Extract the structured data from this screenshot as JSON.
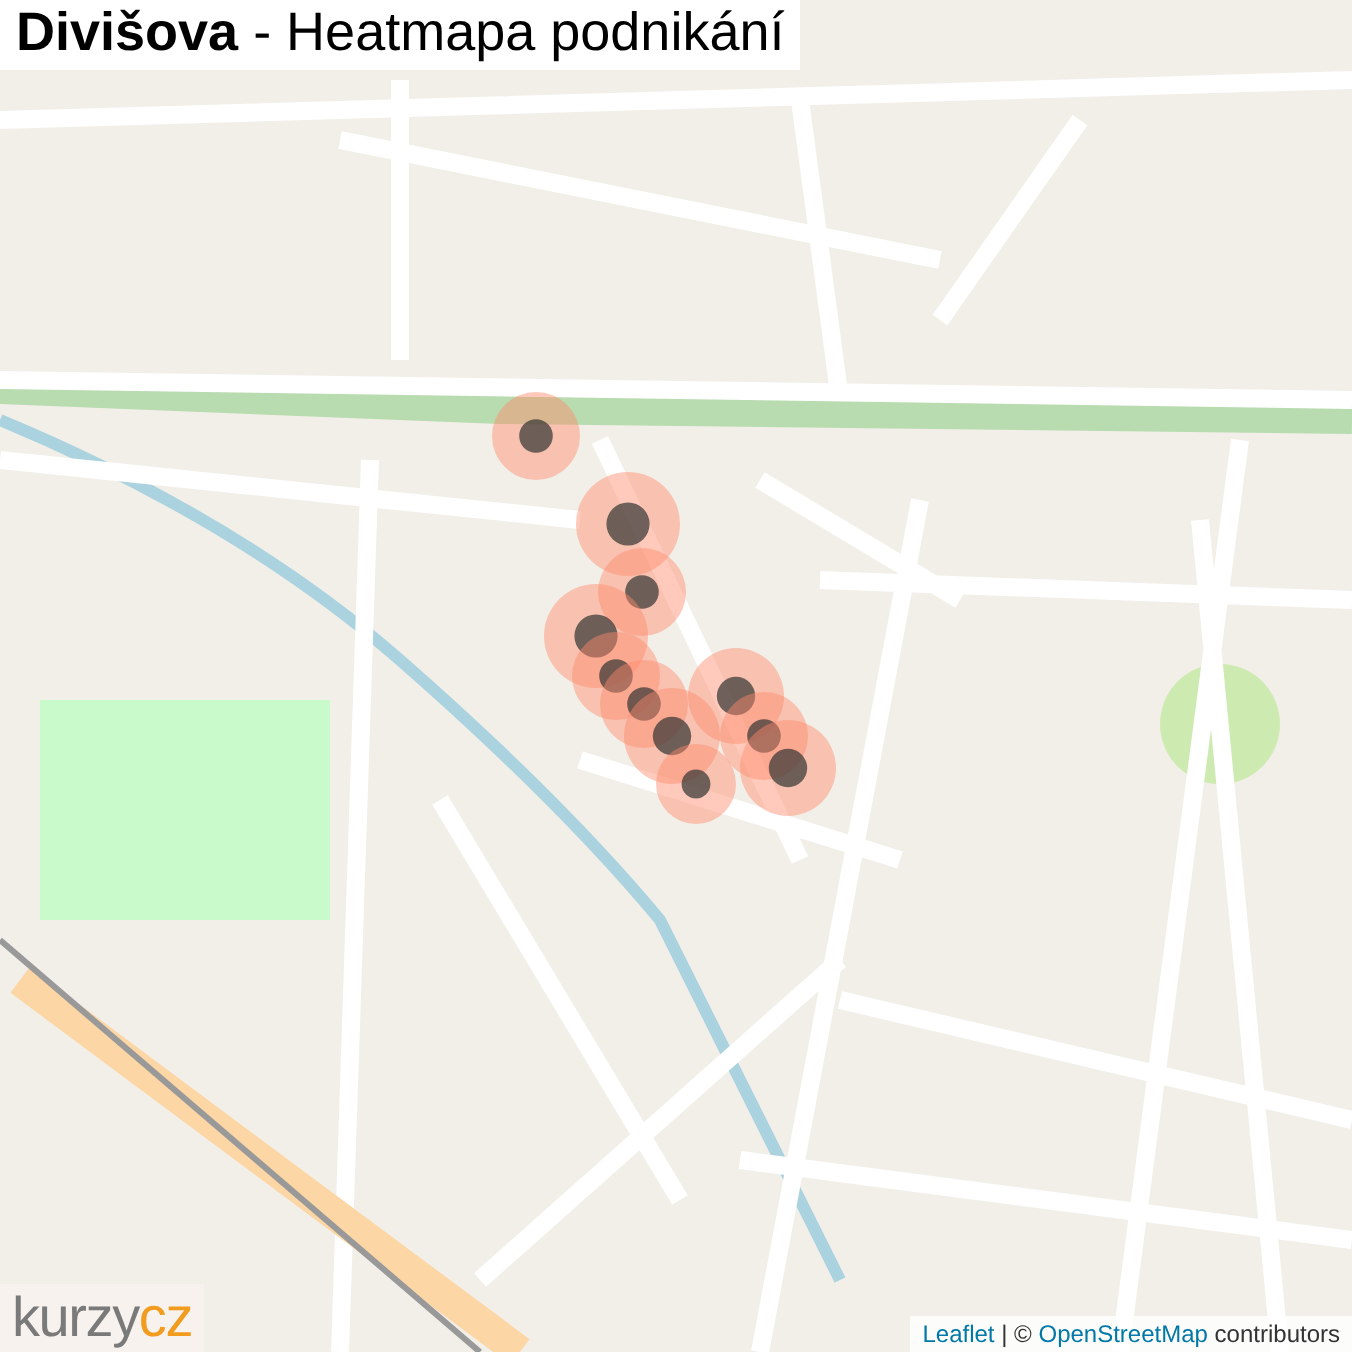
{
  "title": "**Divišova** - Heatmapa podnikání",
  "logo": {
    "text": "kurzy",
    "accent": "cz"
  },
  "attribution": {
    "leaflet": "Leaflet",
    "separator": "| ©",
    "osm": "OpenStreetMap",
    "suffix": "contributors"
  }
}
